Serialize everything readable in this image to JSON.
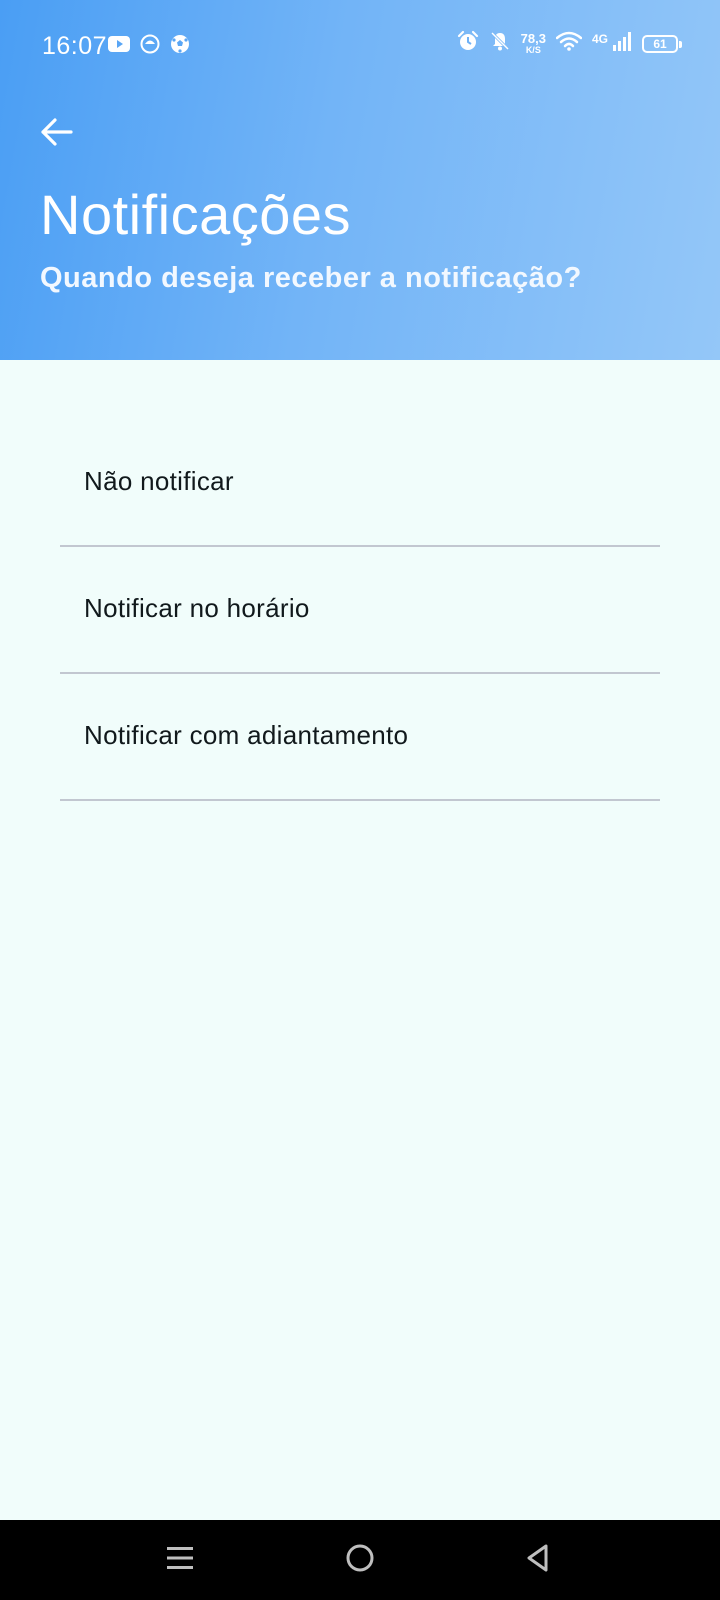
{
  "status_bar": {
    "time": "16:07",
    "net_speed_value": "78,3",
    "net_speed_unit": "K/S",
    "network_type": "4G",
    "battery_level": "61",
    "left_icons": [
      "youtube-icon",
      "app-notification-icon",
      "soccer-ball-icon"
    ],
    "right_icons": [
      "alarm-icon",
      "notifications-off-icon",
      "wifi-icon",
      "signal-icon",
      "battery-icon"
    ]
  },
  "header": {
    "back_icon": "arrow-left-icon",
    "title": "Notificações",
    "subtitle": "Quando deseja receber a notificação?",
    "gradient_start": "#4a9ef4",
    "gradient_end": "#94c7f8"
  },
  "options": [
    {
      "label": "Não notificar"
    },
    {
      "label": "Notificar no horário"
    },
    {
      "label": "Notificar com adiantamento"
    }
  ],
  "nav_bar": {
    "buttons": [
      "menu-icon",
      "home-icon",
      "back-triangle-icon"
    ]
  },
  "colors": {
    "background": "#f1fdfb",
    "divider": "#c2c7d0",
    "text": "#11191c"
  }
}
